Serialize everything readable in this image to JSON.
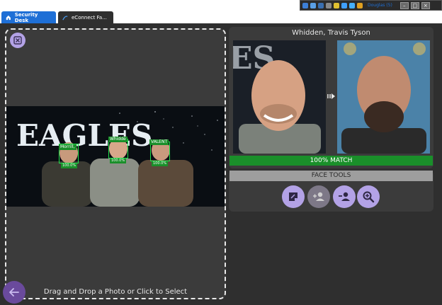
{
  "tabs": [
    {
      "label": "Security Desk",
      "active": true
    },
    {
      "label": "eConnect Fa...",
      "active": false
    }
  ],
  "tray": {
    "label": "Douglas (5)"
  },
  "drop_zone": {
    "instruction": "Drag and Drop a Photo or Click to Select"
  },
  "photo": {
    "banner_text": "EAGLES",
    "faces": [
      {
        "name": "Morrill,",
        "score": "100.0%"
      },
      {
        "name": "Whidde",
        "score": "100.0%"
      },
      {
        "name": "VALENT",
        "score": "100.0%"
      }
    ]
  },
  "match": {
    "name": "Whidden, Travis Tyson",
    "result": "100% MATCH"
  },
  "face_tools": {
    "title": "FACE TOOLS",
    "buttons": [
      {
        "icon": "edit-note-icon"
      },
      {
        "icon": "add-person-icon"
      },
      {
        "icon": "remove-person-icon"
      },
      {
        "icon": "magnify-plus-icon"
      }
    ]
  },
  "colors": {
    "accent": "#b3a2e6",
    "match_green": "#1a8f2a",
    "tab_blue": "#1e6fd6",
    "panel_bg": "#3b3b3b",
    "app_bg": "#2f2f2f"
  }
}
